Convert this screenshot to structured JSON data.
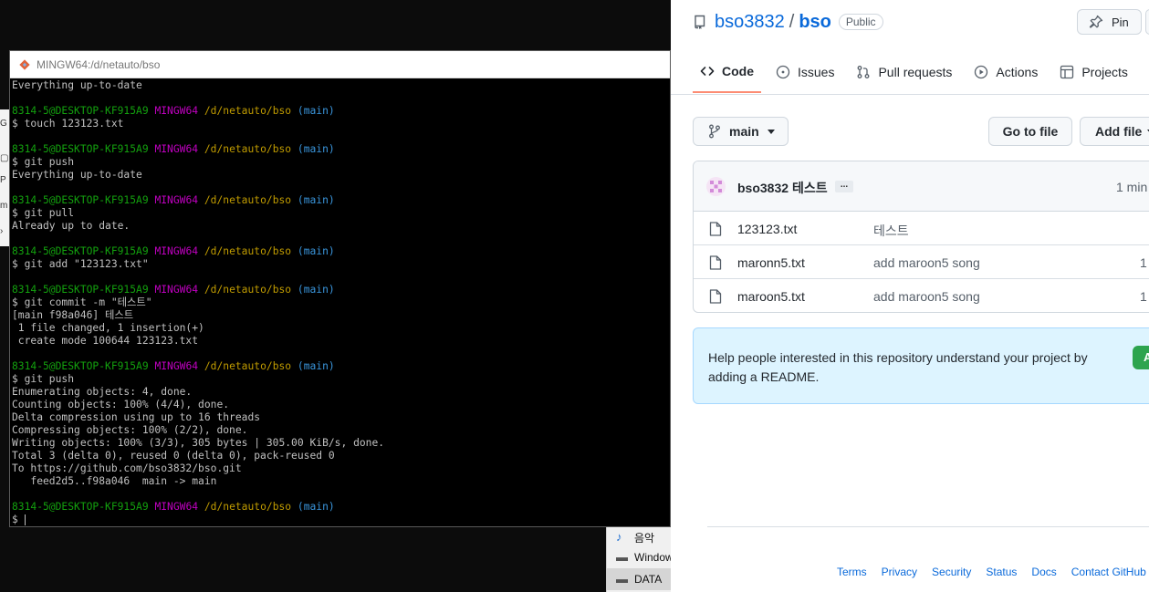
{
  "terminal": {
    "title": "MINGW64:/d/netauto/bso",
    "prompt": {
      "user": "8314-5@DESKTOP-KF915A9",
      "host": "MINGW64",
      "path": "/d/netauto/bso",
      "branch": "(main)"
    },
    "lines": [
      {
        "t": "out",
        "text": "Everything up-to-date"
      },
      {
        "t": "blank"
      },
      {
        "t": "prompt"
      },
      {
        "t": "cmd",
        "text": "$ touch 123123.txt"
      },
      {
        "t": "blank"
      },
      {
        "t": "prompt"
      },
      {
        "t": "cmd",
        "text": "$ git push"
      },
      {
        "t": "out",
        "text": "Everything up-to-date"
      },
      {
        "t": "blank"
      },
      {
        "t": "prompt"
      },
      {
        "t": "cmd",
        "text": "$ git pull"
      },
      {
        "t": "out",
        "text": "Already up to date."
      },
      {
        "t": "blank"
      },
      {
        "t": "prompt"
      },
      {
        "t": "cmd",
        "text": "$ git add \"123123.txt\""
      },
      {
        "t": "blank"
      },
      {
        "t": "prompt"
      },
      {
        "t": "cmd",
        "text": "$ git commit -m \"테스트\""
      },
      {
        "t": "out",
        "text": "[main f98a046] 테스트"
      },
      {
        "t": "out",
        "text": " 1 file changed, 1 insertion(+)"
      },
      {
        "t": "out",
        "text": " create mode 100644 123123.txt"
      },
      {
        "t": "blank"
      },
      {
        "t": "prompt"
      },
      {
        "t": "cmd",
        "text": "$ git push"
      },
      {
        "t": "out",
        "text": "Enumerating objects: 4, done."
      },
      {
        "t": "out",
        "text": "Counting objects: 100% (4/4), done."
      },
      {
        "t": "out",
        "text": "Delta compression using up to 16 threads"
      },
      {
        "t": "out",
        "text": "Compressing objects: 100% (2/2), done."
      },
      {
        "t": "out",
        "text": "Writing objects: 100% (3/3), 305 bytes | 305.00 KiB/s, done."
      },
      {
        "t": "out",
        "text": "Total 3 (delta 0), reused 0 (delta 0), pack-reused 0"
      },
      {
        "t": "out",
        "text": "To https://github.com/bso3832/bso.git"
      },
      {
        "t": "out",
        "text": "   feed2d5..f98a046  main -> main"
      },
      {
        "t": "blank"
      },
      {
        "t": "prompt"
      },
      {
        "t": "input",
        "text": "$ "
      }
    ]
  },
  "background": {
    "explorer_items": [
      {
        "label": "음악",
        "icon": "music-note-icon"
      },
      {
        "label": "Windows",
        "icon": "drive-icon"
      },
      {
        "label": "DATA",
        "icon": "drive-icon"
      }
    ]
  },
  "github": {
    "owner": "bso3832",
    "separator": "/",
    "repo": "bso",
    "visibility": "Public",
    "pin_label": "Pin",
    "tabs": [
      {
        "label": "Code",
        "icon": "code-icon",
        "active": true
      },
      {
        "label": "Issues",
        "icon": "issue-icon",
        "active": false
      },
      {
        "label": "Pull requests",
        "icon": "pull-request-icon",
        "active": false
      },
      {
        "label": "Actions",
        "icon": "play-icon",
        "active": false
      },
      {
        "label": "Projects",
        "icon": "table-icon",
        "active": false
      }
    ],
    "branch": "main",
    "go_to_file": "Go to file",
    "add_file": "Add file",
    "latest_commit": {
      "author": "bso3832",
      "message": "테스트",
      "ellipsis": "...",
      "time": "1 min"
    },
    "files": [
      {
        "name": "123123.txt",
        "message": "테스트",
        "age": ""
      },
      {
        "name": "maronn5.txt",
        "message": "add maroon5 song",
        "age": "1"
      },
      {
        "name": "maroon5.txt",
        "message": "add maroon5 song",
        "age": "1"
      }
    ],
    "readme_prompt": "Help people interested in this repository understand your project by adding a README.",
    "readme_button": "A",
    "footer_links": [
      "Terms",
      "Privacy",
      "Security",
      "Status",
      "Docs",
      "Contact GitHub"
    ],
    "colors": {
      "link": "#0969da",
      "active_tab": "#fd8c73",
      "readme_bg": "#ddf4ff",
      "green": "#2da44e"
    }
  }
}
